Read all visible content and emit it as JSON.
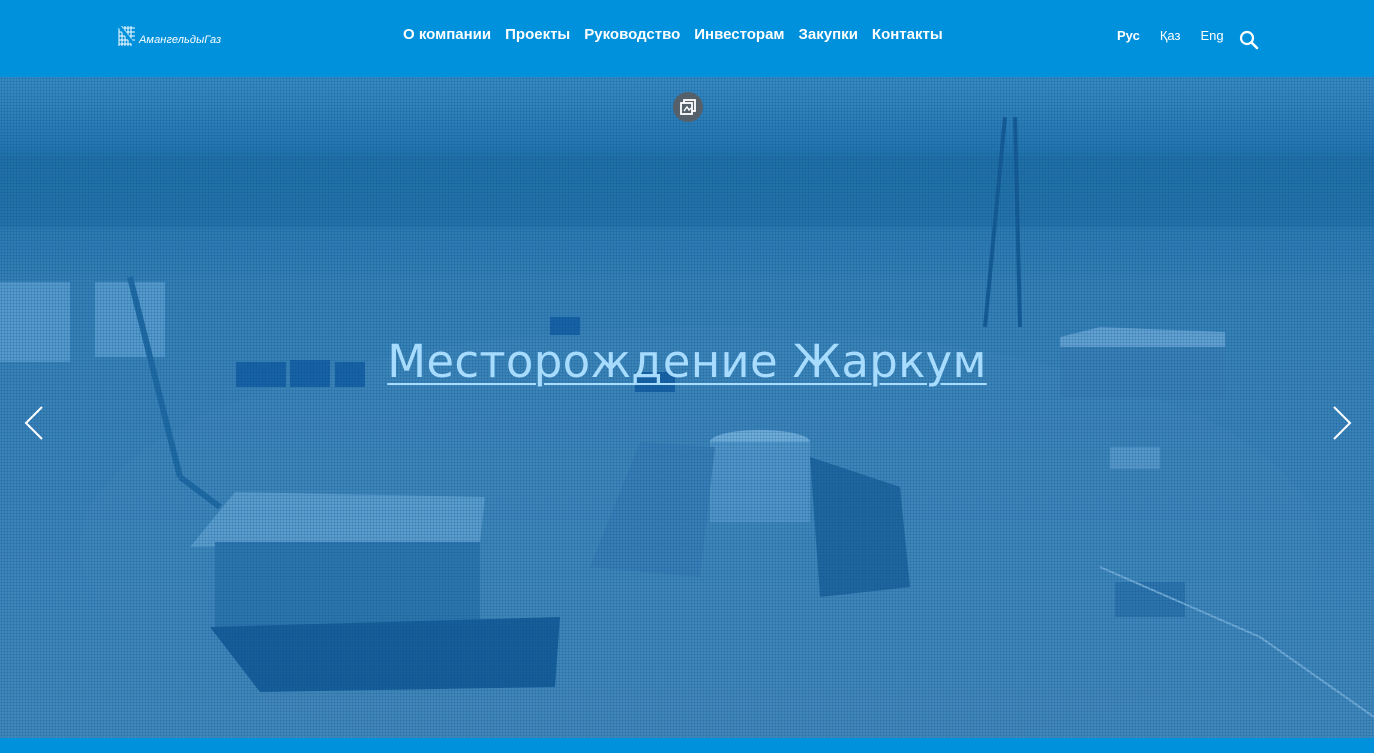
{
  "brand": {
    "logo_text": "АмангельдыГаз"
  },
  "nav": {
    "items": [
      {
        "label": "О компании"
      },
      {
        "label": "Проекты"
      },
      {
        "label": "Руководство"
      },
      {
        "label": "Инвесторам"
      },
      {
        "label": "Закупки"
      },
      {
        "label": "Контакты"
      }
    ]
  },
  "languages": {
    "items": [
      {
        "label": "Рус"
      },
      {
        "label": "Қаз"
      },
      {
        "label": "Eng"
      }
    ],
    "active": "Рус"
  },
  "icons": {
    "search": "search-icon",
    "gallery": "gallery-icon",
    "prev": "chevron-left-icon",
    "next": "chevron-right-icon"
  },
  "hero": {
    "title": "Месторождение Жаркум"
  },
  "colors": {
    "brand_blue": "#0091dc",
    "title_link": "#a8dcff",
    "gallery_button": "#55606b"
  }
}
